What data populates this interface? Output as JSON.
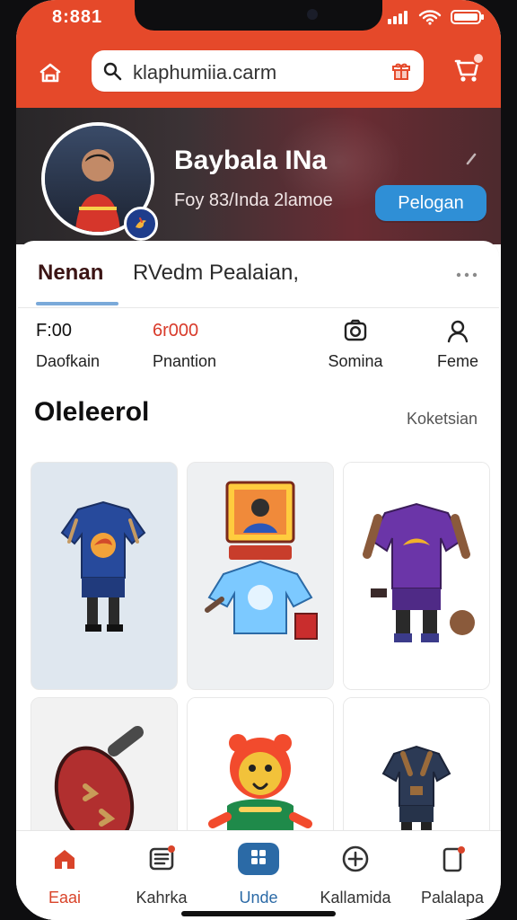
{
  "status_bar": {
    "time": "8:881"
  },
  "header": {
    "search": {
      "value": "klaphumiia.carm"
    }
  },
  "profile": {
    "name": "Baybala INa",
    "subtitle": "Foy 83/Inda 2lamoe",
    "action_label": "Pelogan"
  },
  "tabs": {
    "items": [
      {
        "label": "Nenan"
      },
      {
        "label": "RVedm Pealaian,"
      }
    ]
  },
  "stats": [
    {
      "value": "F:00",
      "label": "Daofkain"
    },
    {
      "value": "6r000",
      "label": "Pnantion"
    },
    {
      "value": "",
      "label": "Somina",
      "icon": "camera-icon"
    },
    {
      "value": "",
      "label": "Feme",
      "icon": "user-icon"
    }
  ],
  "section": {
    "title": "Oleleerol",
    "link": "Koketsian"
  },
  "products": [
    {
      "name": "blue-jersey"
    },
    {
      "name": "sticker-card-and-shirt"
    },
    {
      "name": "purple-armor-kit"
    },
    {
      "name": "red-shield"
    },
    {
      "name": "lion-mascot"
    },
    {
      "name": "dark-gear-set"
    }
  ],
  "bottom_nav": {
    "items": [
      {
        "label": "Eaai",
        "icon": "home-icon",
        "active": true
      },
      {
        "label": "Kahrka",
        "icon": "list-icon",
        "active": false
      },
      {
        "label": "Unde",
        "icon": "grid-icon",
        "active": false
      },
      {
        "label": "Kallamida",
        "icon": "plus-circle-icon",
        "active": false
      },
      {
        "label": "Palalapa",
        "icon": "bookmark-icon",
        "active": false
      }
    ]
  },
  "colors": {
    "accent": "#e5492a",
    "primary_button": "#2f8fd6",
    "nav_active": "#d9442a"
  }
}
